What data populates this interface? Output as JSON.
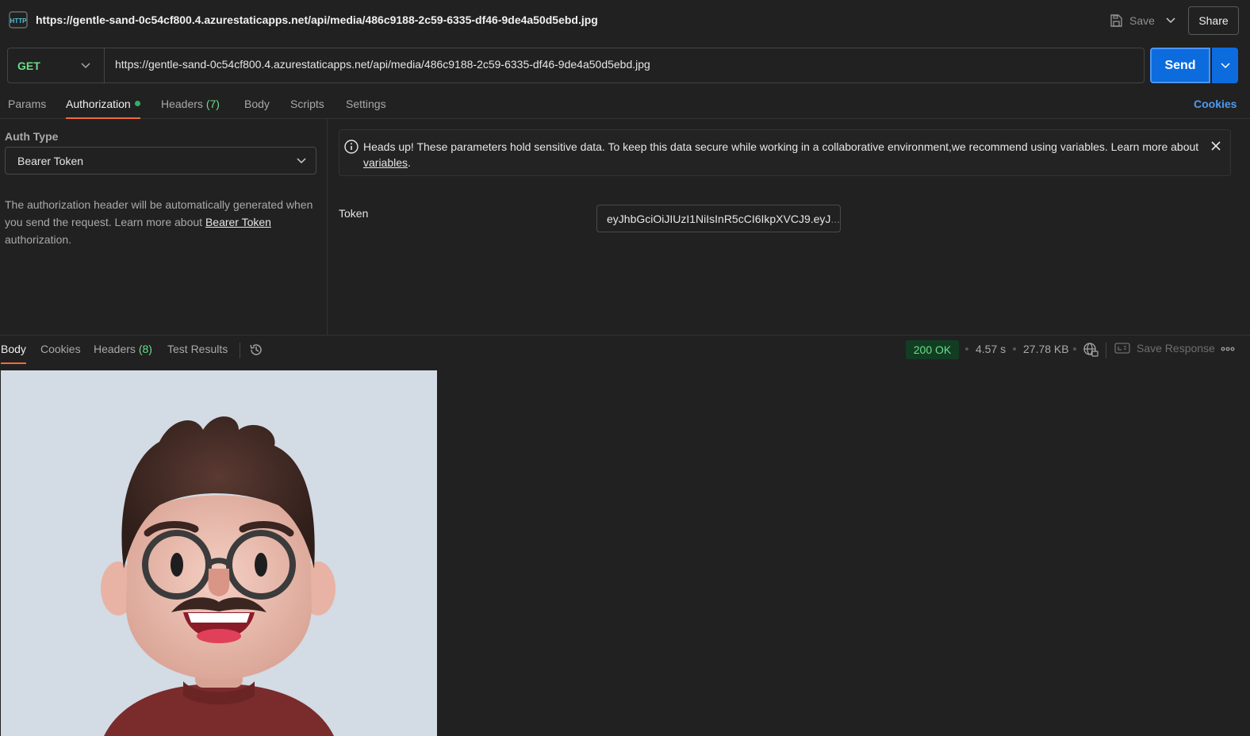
{
  "title": {
    "url": "https://gentle-sand-0c54cf800.4.azurestaticapps.net/api/media/486c9188-2c59-6335-df46-9de4a50d5ebd.jpg",
    "save_label": "Save",
    "share_label": "Share",
    "http_icon": "http-file-icon"
  },
  "request": {
    "method": "GET",
    "url": "https://gentle-sand-0c54cf800.4.azurestaticapps.net/api/media/486c9188-2c59-6335-df46-9de4a50d5ebd.jpg",
    "send_label": "Send"
  },
  "tabs": {
    "params": "Params",
    "authorization": "Authorization",
    "headers": "Headers",
    "headers_count": "(7)",
    "body": "Body",
    "scripts": "Scripts",
    "settings": "Settings",
    "cookies": "Cookies"
  },
  "auth": {
    "type_label": "Auth Type",
    "type_value": "Bearer Token",
    "desc_before": "The authorization header will be automatically generated when you send the request. Learn more about ",
    "desc_link": "Bearer Token",
    "desc_after": " authorization."
  },
  "warning": {
    "text": "Heads up! These parameters hold sensitive data. To keep this data secure while working in a collaborative environment,we recommend using variables. Learn more about ",
    "link": "variables",
    "end": "."
  },
  "token": {
    "label": "Token",
    "value": "eyJhbGciOiJIUzI1NiIsInR5cCI6IkpXVCJ9.eyJ",
    "ellipsis": "..."
  },
  "response": {
    "tabs": {
      "body": "Body",
      "cookies": "Cookies",
      "headers": "Headers",
      "headers_count": "(8)",
      "test_results": "Test Results"
    },
    "status": "200 OK",
    "time": "4.57 s",
    "size": "27.78 KB",
    "save_response": "Save Response"
  },
  "colors": {
    "accent_blue": "#0c6cde",
    "tab_underline": "#f26b3a",
    "success_green": "#6bdd8a"
  }
}
